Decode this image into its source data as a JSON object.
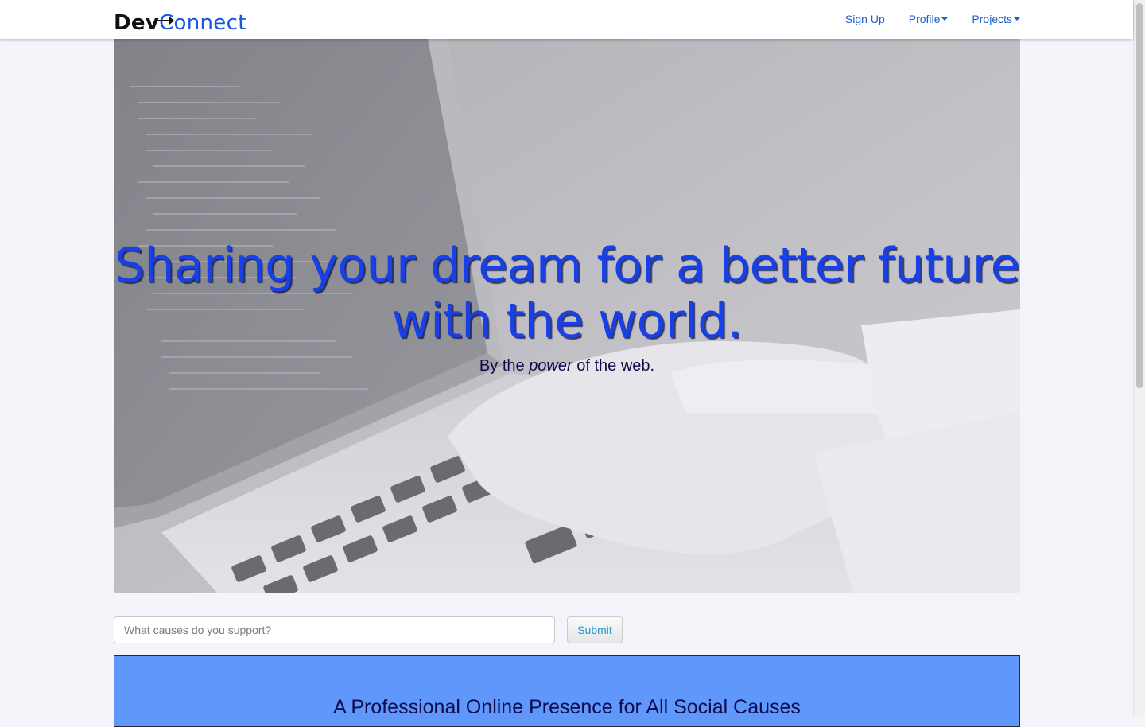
{
  "navbar": {
    "brand": {
      "part1": "Dev",
      "part2": "C",
      "part3": "onnect"
    },
    "links": [
      {
        "label": "Sign Up"
      },
      {
        "label": "Profile"
      },
      {
        "label": "Projects"
      }
    ]
  },
  "hero": {
    "title": "Sharing your dream for a better future with the world.",
    "subtitle_prefix": "By the ",
    "subtitle_emphasis": "power",
    "subtitle_suffix": " of the web."
  },
  "search": {
    "placeholder": "What causes do you support?",
    "value": "",
    "submit_label": "Submit"
  },
  "feature": {
    "title": "A Professional Online Presence for All Social Causes"
  },
  "colors": {
    "accent": "#1a56e0",
    "hero_title": "#1840e8",
    "feature_panel": "#5f97fb"
  }
}
